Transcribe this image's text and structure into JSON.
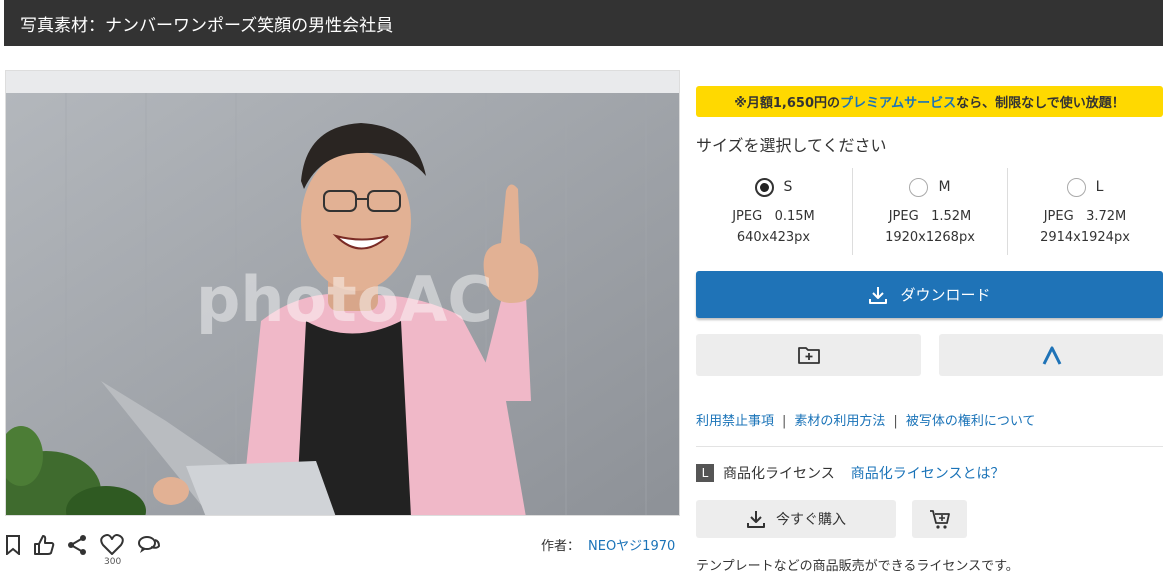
{
  "header": {
    "title": "写真素材：ナンバーワンポーズ笑顔の男性会社員"
  },
  "photo": {
    "watermark": "photoAC"
  },
  "tools": {
    "icons": [
      "bookmark-icon",
      "thumbs-up-icon",
      "share-icon",
      "heart-icon",
      "comment-icon"
    ],
    "like_count": "300"
  },
  "author": {
    "label": "作者：",
    "name": "NEOヤジ1970"
  },
  "promo": {
    "prefix": "※月額1,650円の",
    "highlight": "プレミアムサービス",
    "suffix": "なら、制限なしで使い放題！"
  },
  "size_select": {
    "title": "サイズを選択してください",
    "options": [
      {
        "label": "S",
        "format": "JPEG",
        "filesize": "0.15M",
        "dimensions": "640x423px",
        "checked": true
      },
      {
        "label": "M",
        "format": "JPEG",
        "filesize": "1.52M",
        "dimensions": "1920x1268px",
        "checked": false
      },
      {
        "label": "L",
        "format": "JPEG",
        "filesize": "3.72M",
        "dimensions": "2914x1924px",
        "checked": false
      }
    ]
  },
  "download": {
    "label": "ダウンロード"
  },
  "links": [
    {
      "label": "利用禁止事項"
    },
    {
      "label": "素材の利用方法"
    },
    {
      "label": "被写体の権利について"
    }
  ],
  "license": {
    "badge": "L",
    "label": "商品化ライセンス",
    "what_link": "商品化ライセンスとは？"
  },
  "buy": {
    "label": "今すぐ購入"
  },
  "description": "テンプレートなどの商品販売ができるライセンスです。",
  "colors": {
    "accent": "#1f73b7",
    "promo_bg": "#ffd900",
    "header_bg": "#333333"
  }
}
